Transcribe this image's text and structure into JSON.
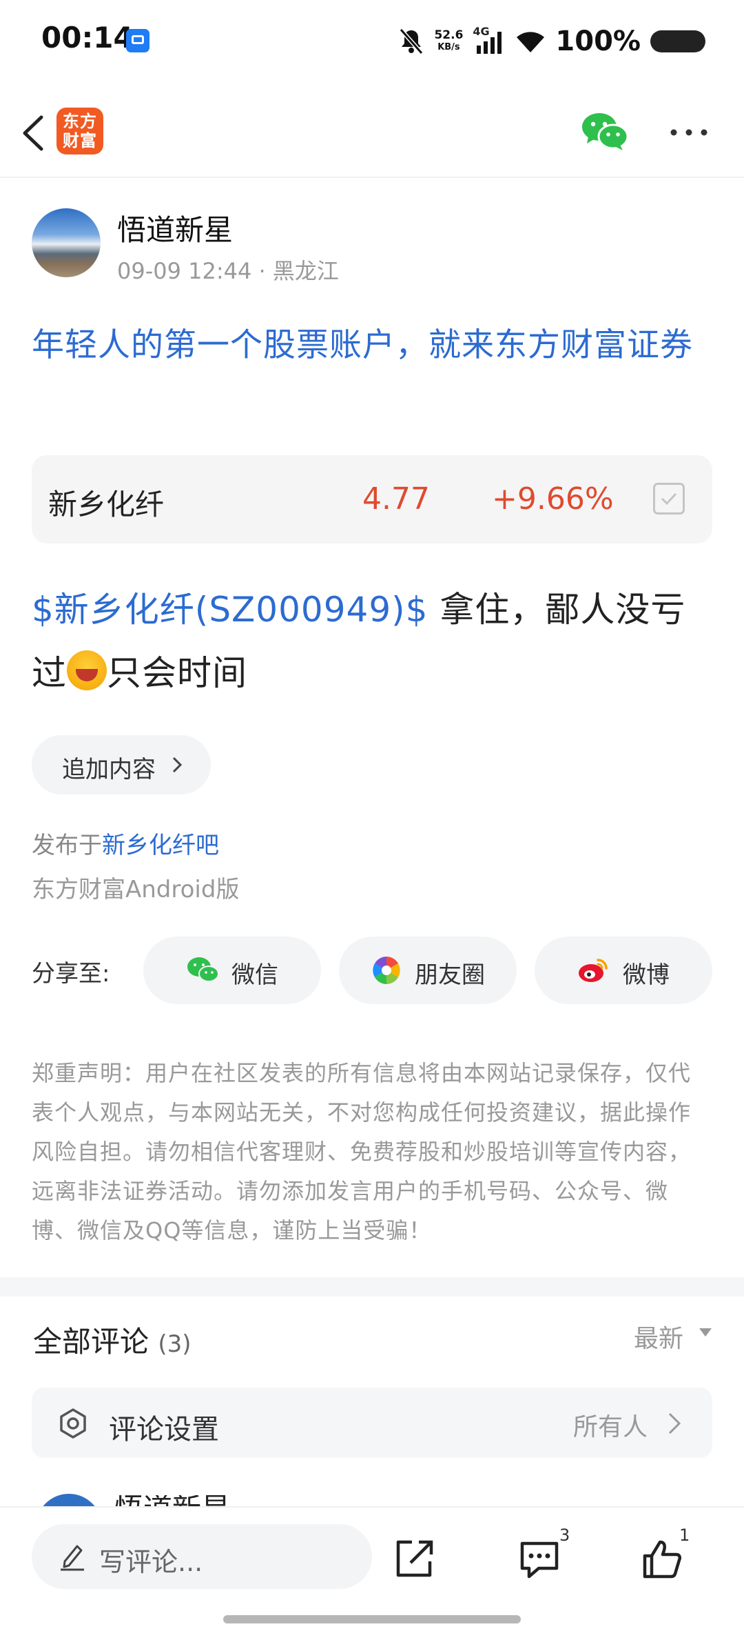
{
  "status_bar": {
    "time": "00:14",
    "speed_value": "52.6",
    "speed_unit": "KB/s",
    "network": "4G",
    "battery": "100%"
  },
  "nav": {
    "logo_line1": "东方",
    "logo_line2": "财富",
    "accent": "#f15a22"
  },
  "post": {
    "author": "悟道新星",
    "meta": "09-09 12:44 · 黑龙江",
    "title": "年轻人的第一个股票账户，就来东方财富证券",
    "stock": {
      "name": "新乡化纤",
      "price": "4.77",
      "change": "+9.66%"
    },
    "body_link": "$新乡化纤(SZ000949)$",
    "body_text_1": " 拿住，鄙人没亏过",
    "body_text_2": "只会时间",
    "add_content": "追加内容",
    "published_prefix": "发布于",
    "published_bar": "新乡化纤吧",
    "client": "东方财富Android版"
  },
  "share": {
    "label": "分享至:",
    "options": [
      {
        "label": "微信",
        "icon": "wechat-icon"
      },
      {
        "label": "朋友圈",
        "icon": "moments-icon"
      },
      {
        "label": "微博",
        "icon": "weibo-icon"
      }
    ]
  },
  "disclaimer": "郑重声明：用户在社区发表的所有信息将由本网站记录保存，仅代表个人观点，与本网站无关，不对您构成任何投资建议，据此操作风险自担。请勿相信代客理财、免费荐股和炒股培训等宣传内容，远离非法证券活动。请勿添加发言用户的手机号码、公众号、微博、微信及QQ等信息，谨防上当受骗！",
  "comments": {
    "title": "全部评论",
    "count": "(3)",
    "sort": "最新",
    "settings_label": "评论设置",
    "settings_value": "所有人",
    "first_author": "悟道新星"
  },
  "bottom_bar": {
    "placeholder": "写评论...",
    "comment_count": "3",
    "like_count": "1"
  },
  "colors": {
    "link_blue": "#2c6bd1",
    "up_red": "#e04a2e"
  }
}
